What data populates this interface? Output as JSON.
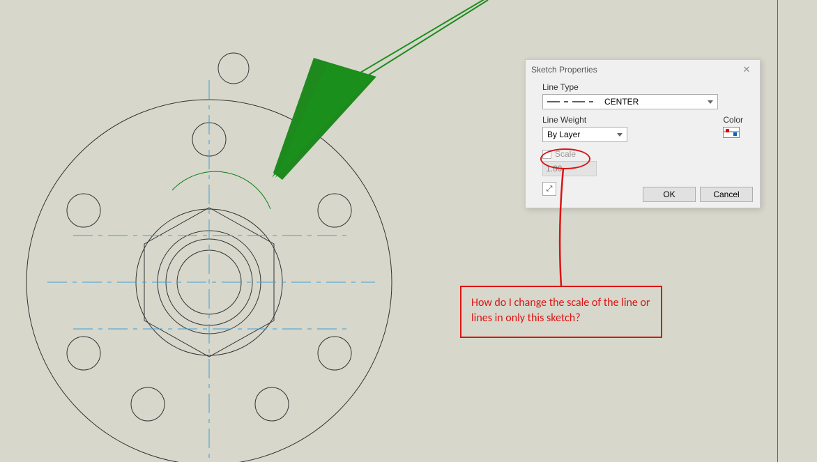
{
  "dialog": {
    "title": "Sketch Properties",
    "line_type_label": "Line Type",
    "line_type_value": "CENTER",
    "line_weight_label": "Line Weight",
    "line_weight_value": "By Layer",
    "color_label": "Color",
    "scale_label": "Scale",
    "scale_value": "1.00",
    "ok_label": "OK",
    "cancel_label": "Cancel"
  },
  "annotation": {
    "text": "How do I change the scale of the line or lines in only this sketch?"
  }
}
